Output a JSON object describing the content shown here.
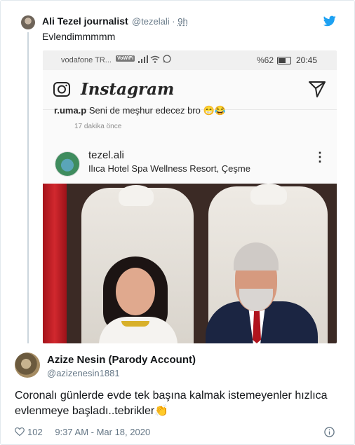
{
  "tweet1": {
    "name": "Ali Tezel journalist",
    "handle": "@tezelali",
    "separator": "·",
    "age": "9h",
    "text": "Evlendimmmmm"
  },
  "embedded_screenshot": {
    "status_bar": {
      "carrier": "vodafone TR...",
      "wifi_badge": "VoWiFi",
      "battery_pct": "%62",
      "time": "20:45"
    },
    "instagram": {
      "logo_text": "Instagram",
      "comment_user": "r.uma.p",
      "comment_text": "Seni de meşhur edecez bro",
      "comment_time": "17 dakika önce",
      "post_user": "tezel.ali",
      "post_location": "Ilıca Hotel Spa Wellness Resort, Çeşme",
      "more_icon": "⋮"
    }
  },
  "tweet2": {
    "name": "Azize Nesin (Parody Account)",
    "handle": "@azizenesin1881",
    "text": "Coronalı günlerde evde tek başına kalmak istemeyenler hızlıca evlenmeye başladı..tebrikler",
    "emoji": "👏",
    "likes": "102",
    "timestamp": "9:37 AM - Mar 18, 2020"
  },
  "colors": {
    "twitter_blue": "#1da1f2",
    "secondary_text": "#657786",
    "thread_line": "#ccd6dd"
  },
  "icons": [
    "twitter-bird-icon",
    "instagram-camera-icon",
    "instagram-direct-icon",
    "more-options-icon",
    "heart-icon",
    "info-icon"
  ]
}
